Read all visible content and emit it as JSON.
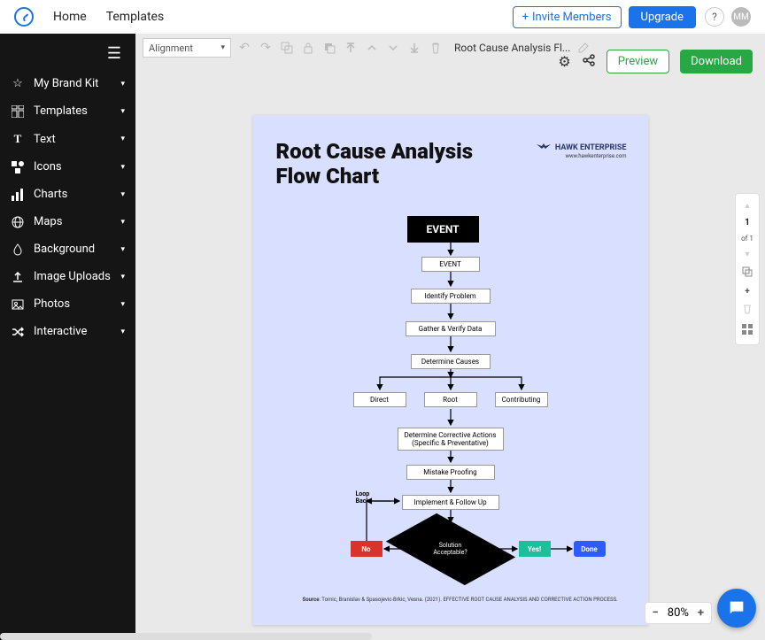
{
  "header": {
    "nav": [
      "Home",
      "Templates"
    ],
    "invite": "Invite Members",
    "upgrade": "Upgrade",
    "help": "?",
    "avatar": "MM"
  },
  "sidebar": {
    "items": [
      {
        "label": "My Brand Kit",
        "icon": "star"
      },
      {
        "label": "Templates",
        "icon": "grid"
      },
      {
        "label": "Text",
        "icon": "text"
      },
      {
        "label": "Icons",
        "icon": "shapes"
      },
      {
        "label": "Charts",
        "icon": "bar"
      },
      {
        "label": "Maps",
        "icon": "globe"
      },
      {
        "label": "Background",
        "icon": "drop"
      },
      {
        "label": "Image Uploads",
        "icon": "upload"
      },
      {
        "label": "Photos",
        "icon": "photo"
      },
      {
        "label": "Interactive",
        "icon": "shuffle"
      }
    ]
  },
  "toolbar": {
    "alignment": "Alignment",
    "docname": "Root Cause Analysis Fl..."
  },
  "actions": {
    "preview": "Preview",
    "download": "Download"
  },
  "page_indicator": {
    "num": "1",
    "of": "of 1"
  },
  "zoom": {
    "level": "80%"
  },
  "document": {
    "title_l1": "Root Cause Analysis",
    "title_l2": "Flow Chart",
    "brand": "HAWK ENTERPRISE",
    "brand_url": "www.hawkenterprise.com",
    "nodes": {
      "event_big": "EVENT",
      "event": "EVENT",
      "identify": "Identify Problem",
      "gather": "Gather & Verify Data",
      "determine": "Determine Causes",
      "direct": "Direct",
      "root": "Root",
      "contributing": "Contributing",
      "corrective": "Determine Corrective Actions (Specific & Preventative)",
      "mistake": "Mistake Proofing",
      "implement": "Implement & Follow Up",
      "solution_l1": "Solution",
      "solution_l2": "Acceptable?",
      "no": "No",
      "yes": "Yes!",
      "done": "Done",
      "loop_l1": "Loop",
      "loop_l2": "Back"
    },
    "source_label": "Source",
    "source_text": ": Tomic, Branislav & Spasojevic-Brkic, Vesna. (2021). EFFECTIVE ROOT CAUSE ANALYSIS AND CORRECTIVE ACTION PROCESS."
  }
}
